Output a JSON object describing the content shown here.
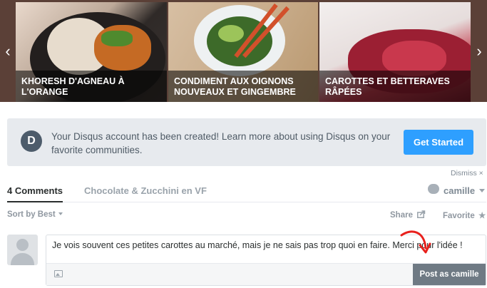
{
  "carousel": {
    "slides": [
      {
        "caption": "KHORESH D'AGNEAU À L'ORANGE"
      },
      {
        "caption": "CONDIMENT AUX OIGNONS NOUVEAUX ET GINGEMBRE"
      },
      {
        "caption": "CAROTTES ET BETTERAVES RÂPÉES"
      }
    ],
    "prev_icon": "chevron-left-icon",
    "next_icon": "chevron-right-icon"
  },
  "notice": {
    "logo_letter": "D",
    "text": "Your Disqus account has been created! Learn more about using Disqus on your favorite communities.",
    "button_label": "Get Started",
    "dismiss_label": "Dismiss ×"
  },
  "tabs": {
    "comments_label": "4 Comments",
    "community_label": "Chocolate & Zucchini en VF"
  },
  "user": {
    "name": "camille"
  },
  "toolbar": {
    "sort_label": "Sort by Best",
    "share_label": "Share",
    "favorite_label": "Favorite"
  },
  "composer": {
    "text": "Je vois souvent ces petites carottes au marché, mais je ne sais pas trop quoi en faire. Merci pour l'idée !",
    "post_label": "Post as camille"
  },
  "colors": {
    "accent": "#2e9fff",
    "post_button": "#6f7a84",
    "annotation": "#e8201c"
  }
}
